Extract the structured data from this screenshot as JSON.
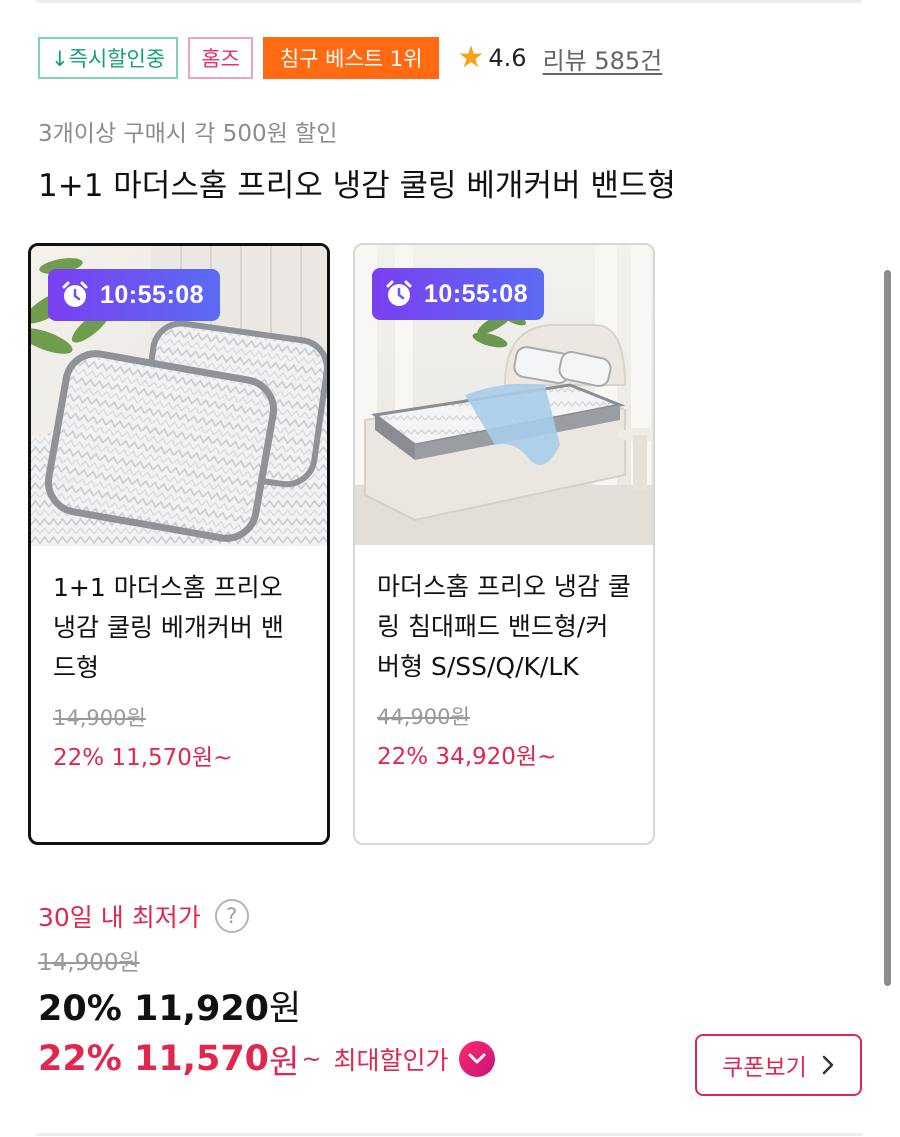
{
  "badges": {
    "instant_discount": "↓즉시할인중",
    "homes": "홈즈",
    "best": "침구 베스트 1위"
  },
  "rating": {
    "score": "4.6",
    "review": "리뷰 585건"
  },
  "promo_subtitle": "3개이상 구매시 각 500원 할인",
  "product_title": "1+1 마더스홈 프리오 냉감 쿨링 베개커버 밴드형",
  "options": [
    {
      "timer": "10:55:08",
      "name": "1+1 마더스홈 프리오 냉감 쿨링 베개커버 밴드형",
      "original_price": "14,900원",
      "sale_price": "22% 11,570원~",
      "selected": true
    },
    {
      "timer": "10:55:08",
      "name": "마더스홈 프리오 냉감 쿨링 침대패드 밴드형/커버형 S/SS/Q/K/LK",
      "original_price": "44,900원",
      "sale_price": "22% 34,920원~",
      "selected": false
    }
  ],
  "price": {
    "lowest_label": "30일 내 최저가",
    "help_icon": "question-icon",
    "original": "14,900원",
    "current_value": "20% 11,920",
    "current_unit": "원",
    "max_value": "22% 11,570",
    "max_unit": "원",
    "max_tilde": "~",
    "max_label": "최대할인가"
  },
  "coupon_button": "쿠폰보기",
  "colors": {
    "accent": "#e0284f",
    "best_badge": "#ff6a13",
    "instant_badge": "#14a07a",
    "timer_start": "#7b3ff2",
    "timer_end": "#5a6cf4",
    "star": "#f6a31b"
  }
}
